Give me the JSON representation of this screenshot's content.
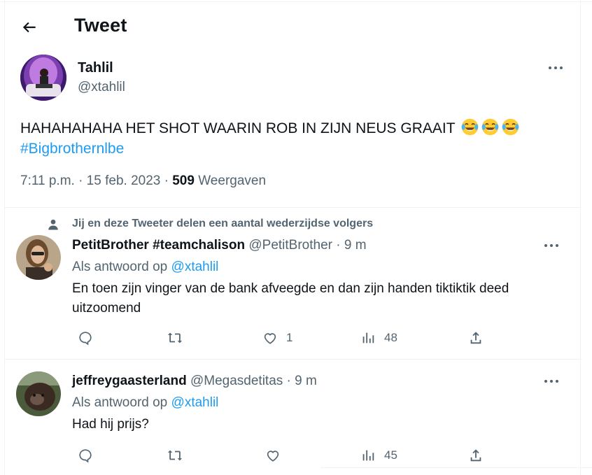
{
  "header": {
    "title": "Tweet"
  },
  "tweet": {
    "author_name": "Tahlil",
    "author_handle": "@xtahlil",
    "text": "HAHAHAHAHA HET SHOT WAARIN ROB IN ZIJN NEUS GRAAIT",
    "emoji_count": 3,
    "hashtag": "#Bigbrothernlbe",
    "time": "7:11 p.m. · 15 feb. 2023 ·",
    "views_count": "509",
    "views_label": "Weergaven"
  },
  "mutual_notice": "Jij en deze Tweeter delen een aantal wederzijdse volgers",
  "replies": [
    {
      "name": "PetitBrother #teamchalison",
      "handle_time": "@PetitBrother · 9 m",
      "reply_prefix": "Als antwoord op",
      "reply_to": "@xtahlil",
      "text": "En toen zijn vinger van de bank afveegde en dan zijn handen tiktiktik deed uitzoomend",
      "likes": "1",
      "views": "48"
    },
    {
      "name": "jeffreygaasterland",
      "handle_time": "@Megasdetitas · 9 m",
      "reply_prefix": "Als antwoord op",
      "reply_to": "@xtahlil",
      "text": "Had hij prijs?",
      "likes": "",
      "views": "45"
    }
  ],
  "colors": {
    "accent": "#1d9bf0",
    "muted": "#536471",
    "text": "#0f1419",
    "divider": "#eff3f4"
  },
  "icons": [
    "back-arrow-icon",
    "more-icon",
    "reply-icon",
    "retweet-icon",
    "like-icon",
    "views-icon",
    "share-icon",
    "person-icon",
    "tears-of-joy-emoji"
  ]
}
